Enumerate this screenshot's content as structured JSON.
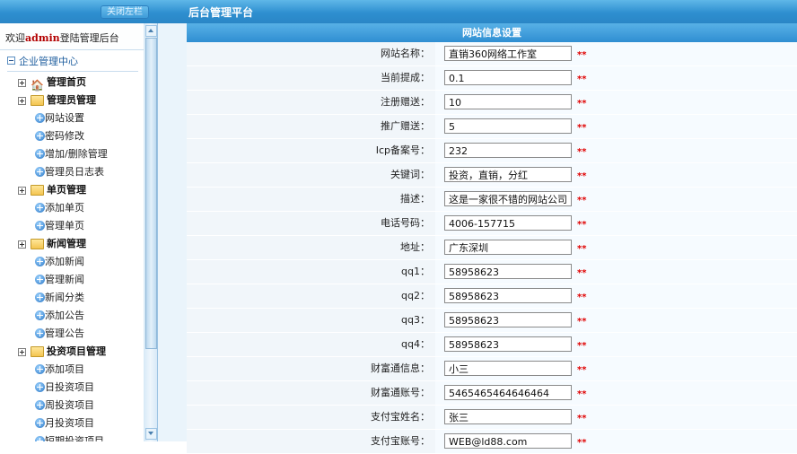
{
  "header": {
    "close_sidebar": "关闭左栏",
    "title": "后台管理平台"
  },
  "sidebar": {
    "welcome_pre": "欢迎",
    "welcome_user": "admin",
    "welcome_post": "登陆管理后台",
    "center_title": "企业管理中心",
    "groups": [
      {
        "label": "管理首页",
        "icon": "home-icon",
        "items": []
      },
      {
        "label": "管理员管理",
        "icon": "folder-icon",
        "items": [
          "网站设置",
          "密码修改",
          "增加/删除管理",
          "管理员日志表"
        ]
      },
      {
        "label": "单页管理",
        "icon": "folder-icon",
        "items": [
          "添加单页",
          "管理单页"
        ]
      },
      {
        "label": "新闻管理",
        "icon": "folder-icon",
        "items": [
          "添加新闻",
          "管理新闻",
          "新闻分类",
          "添加公告",
          "管理公告"
        ]
      },
      {
        "label": "投资项目管理",
        "icon": "folder-icon",
        "items": [
          "添加项目",
          "日投资项目",
          "周投资项目",
          "月投资项目",
          "短期投资项目"
        ]
      }
    ]
  },
  "form": {
    "title": "网站信息设置",
    "required_mark": "**",
    "fields": [
      {
        "label": "网站名称：",
        "value": "直销360网络工作室"
      },
      {
        "label": "当前提成：",
        "value": "0.1"
      },
      {
        "label": "注册赠送：",
        "value": "10"
      },
      {
        "label": "推广赠送：",
        "value": "5"
      },
      {
        "label": "Icp备案号：",
        "value": "232"
      },
      {
        "label": "关键词：",
        "value": "投资，直销，分红"
      },
      {
        "label": "描述：",
        "value": "这是一家很不错的网站公司"
      },
      {
        "label": "电话号码：",
        "value": "4006-157715"
      },
      {
        "label": "地址：",
        "value": "广东深圳"
      },
      {
        "label": "qq1：",
        "value": "58958623"
      },
      {
        "label": "qq2：",
        "value": "58958623"
      },
      {
        "label": "qq3：",
        "value": "58958623"
      },
      {
        "label": "qq4：",
        "value": "58958623"
      },
      {
        "label": "财富通信息：",
        "value": "小三"
      },
      {
        "label": "财富通账号：",
        "value": "5465465464646464"
      },
      {
        "label": "支付宝姓名：",
        "value": "张三"
      },
      {
        "label": "支付宝账号：",
        "value": "WEB@ld88.com"
      }
    ]
  }
}
